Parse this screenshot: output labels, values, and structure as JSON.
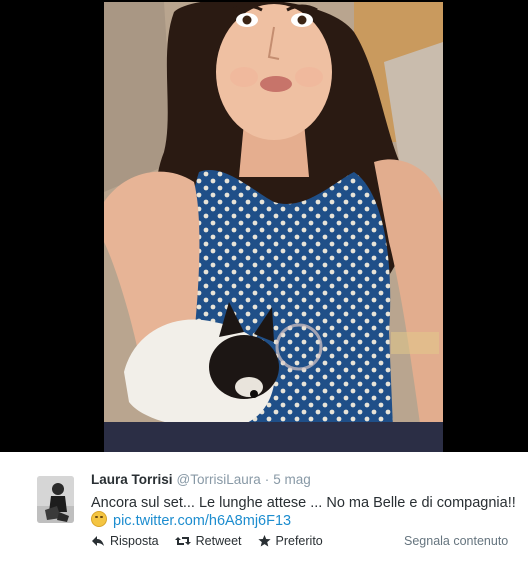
{
  "tweet": {
    "fullname": "Laura Torrisi",
    "username": "@TorrisiLaura",
    "separator": "·",
    "time": "5 mag",
    "text": "Ancora sul set... Le lunghe attese ... No ma Belle e di compagnia!!",
    "link": "pic.twitter.com/h6A8mj6F13",
    "emoji_icon": "worried-face-emoji"
  },
  "actions": {
    "reply": {
      "label": "Risposta",
      "icon": "reply-icon"
    },
    "retweet": {
      "label": "Retweet",
      "icon": "retweet-icon"
    },
    "favorite": {
      "label": "Preferito",
      "icon": "star-icon"
    }
  },
  "report_label": "Segnala contenuto",
  "colors": {
    "link": "#1d8dcf",
    "muted": "#8899a6",
    "text": "#292f33",
    "media_background": "#000000"
  }
}
